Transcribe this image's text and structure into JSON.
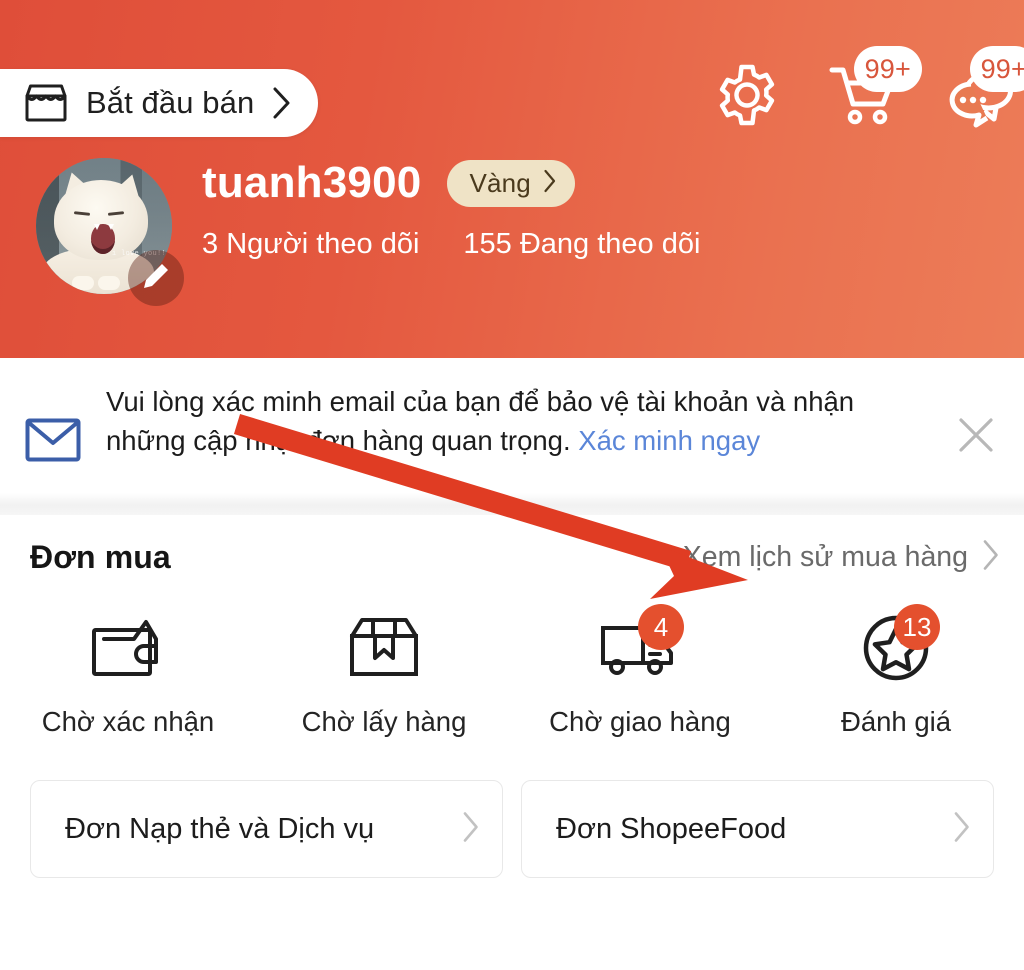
{
  "header": {
    "sell_button": {
      "label": "Bắt đầu bán",
      "icon": "shop-icon",
      "chevron": "chevron-right-icon"
    },
    "actions": [
      {
        "name": "settings",
        "icon": "gear-icon",
        "badge": null
      },
      {
        "name": "cart",
        "icon": "shopping-cart-icon",
        "badge": "99+"
      },
      {
        "name": "chat",
        "icon": "chat-bubbles-icon",
        "badge": "99+"
      }
    ],
    "gradient_from": "#df4e39",
    "gradient_to": "#ec7c58"
  },
  "profile": {
    "username": "tuanh3900",
    "avatar_alt": "cat-avatar",
    "edit_icon": "pencil-icon",
    "tier": {
      "label": "Vàng",
      "chevron": "chevron-right-icon",
      "pill_color": "#efe3c6",
      "text_color": "#4a3a1d"
    },
    "stats": [
      {
        "count": "3",
        "label": "Người theo dõi"
      },
      {
        "count": "155",
        "label": "Đang theo dõi"
      }
    ]
  },
  "banner": {
    "icon": "envelope-icon",
    "icon_color": "#3b5ea8",
    "text_part1": "Vui lòng xác minh email của bạn để bảo vệ tài khoản và nhận những cập nhật đơn hàng quan trọng. ",
    "link_text": "Xác minh ngay",
    "link_color": "#5b86d8",
    "close_icon": "close-icon"
  },
  "orders": {
    "title": "Đơn mua",
    "history_link": "Xem lịch sử mua hàng",
    "history_chevron": "chevron-right-icon",
    "statuses": [
      {
        "label": "Chờ xác nhận",
        "icon": "wallet-icon",
        "badge": null
      },
      {
        "label": "Chờ lấy hàng",
        "icon": "box-icon",
        "badge": null
      },
      {
        "label": "Chờ giao hàng",
        "icon": "truck-icon",
        "badge": "4"
      },
      {
        "label": "Đánh giá",
        "icon": "star-circle-icon",
        "badge": "13"
      }
    ],
    "badge_color": "#e4502e"
  },
  "bottom_cards": [
    {
      "label": "Đơn Nạp thẻ và Dịch vụ",
      "chevron": "chevron-right-icon"
    },
    {
      "label": "Đơn ShopeeFood",
      "chevron": "chevron-right-icon"
    }
  ],
  "annotation": {
    "type": "arrow",
    "color": "#e03c23",
    "from": "(237, 424)",
    "to": "(748, 580)",
    "points_at": "Xem lịch sử mua hàng"
  }
}
